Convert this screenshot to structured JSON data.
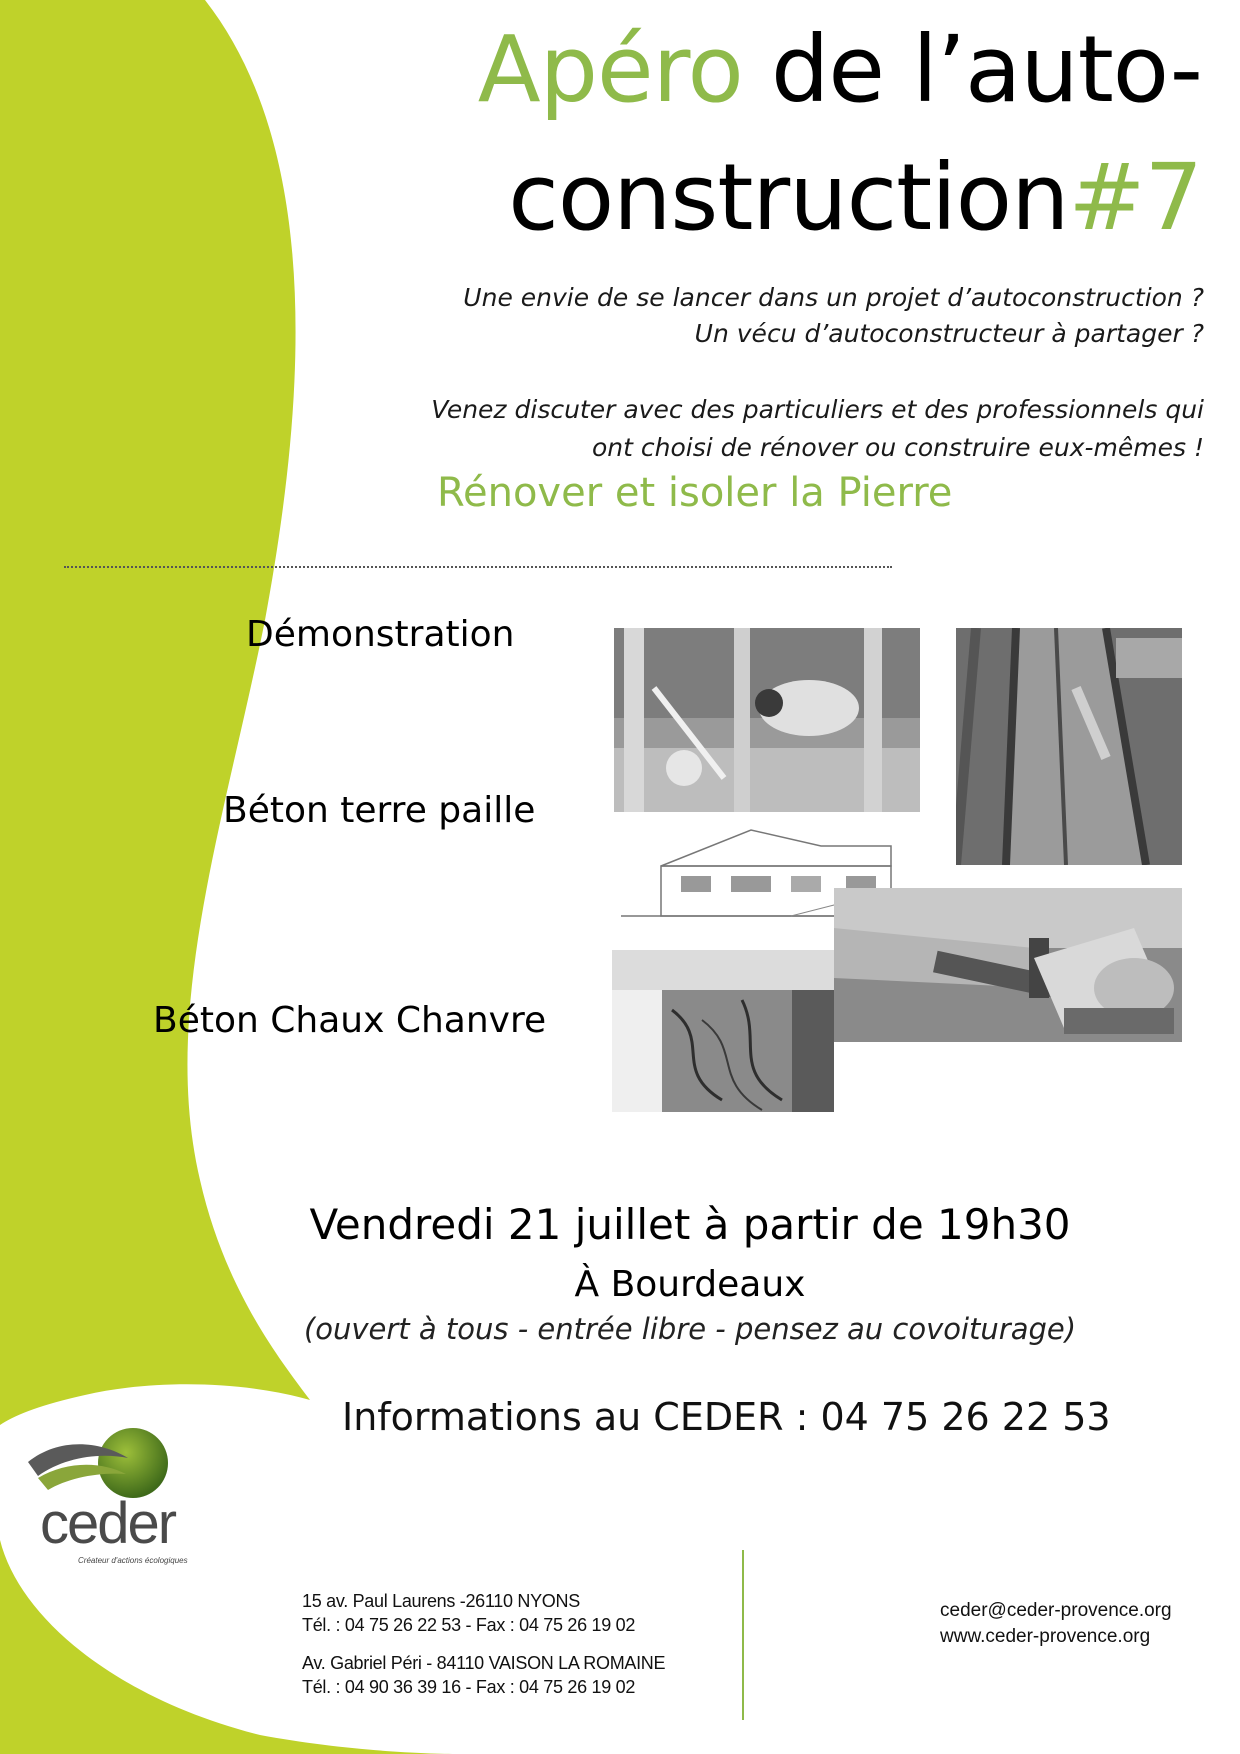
{
  "title": {
    "word1": "Apéro",
    "word2": " de l’auto-",
    "word3": "construction",
    "word4": "#7"
  },
  "intro": {
    "line1": "Une envie de se lancer dans un projet d’autoconstruction ?",
    "line2": "Un vécu d’autoconstructeur à partager ?",
    "line3": "Venez discuter avec des particuliers et des professionnels qui",
    "line4": "ont choisi de rénover ou construire eux-mêmes !"
  },
  "subtitle": "Rénover et isoler la Pierre",
  "topics": [
    "Démonstration",
    "Béton terre paille",
    "Béton Chaux Chanvre"
  ],
  "event": {
    "date": "Vendredi 21 juillet à partir de 19h30",
    "place": "À Bourdeaux",
    "note": "(ouvert à tous - entrée libre - pensez au covoiturage)",
    "info": "Informations au CEDER : 04 75 26 22 53"
  },
  "logo": {
    "name": "ceder",
    "tagline": "Créateur d'actions écologiques"
  },
  "addresses": {
    "a1_line1": "15 av. Paul Laurens -26110 NYONS",
    "a1_line2": "Tél. : 04 75 26 22 53 - Fax : 04 75 26 19 02",
    "a2_line1": "Av. Gabriel Péri - 84110 VAISON LA ROMAINE",
    "a2_line2": "Tél. : 04 90 36 39 16 - Fax : 04 75 26 19 02"
  },
  "contact": {
    "email": "ceder@ceder-provence.org",
    "web": "www.ceder-provence.org"
  },
  "colors": {
    "accent_green": "#8fba4a",
    "swoosh_green": "#bfd22a",
    "text": "#000000"
  }
}
